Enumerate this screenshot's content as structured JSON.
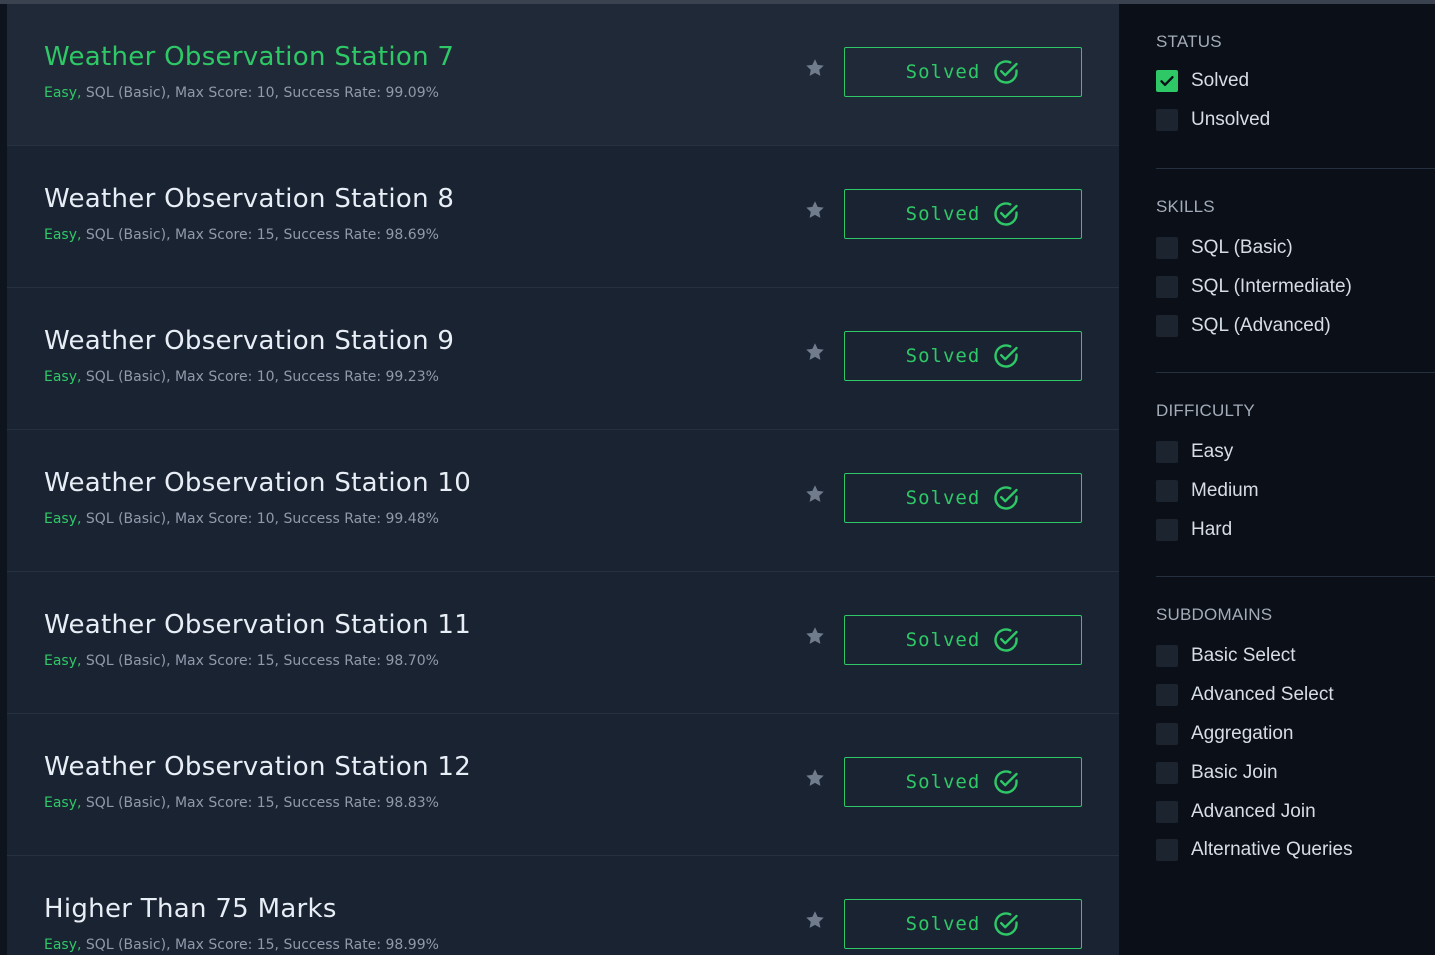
{
  "challenges": [
    {
      "title": "Weather Observation Station 7",
      "difficulty": "Easy,",
      "details": "SQL (Basic), Max Score: 10, Success Rate: 99.09%",
      "button_label": "Solved"
    },
    {
      "title": "Weather Observation Station 8",
      "difficulty": "Easy,",
      "details": "SQL (Basic), Max Score: 15, Success Rate: 98.69%",
      "button_label": "Solved"
    },
    {
      "title": "Weather Observation Station 9",
      "difficulty": "Easy,",
      "details": "SQL (Basic), Max Score: 10, Success Rate: 99.23%",
      "button_label": "Solved"
    },
    {
      "title": "Weather Observation Station 10",
      "difficulty": "Easy,",
      "details": "SQL (Basic), Max Score: 10, Success Rate: 99.48%",
      "button_label": "Solved"
    },
    {
      "title": "Weather Observation Station 11",
      "difficulty": "Easy,",
      "details": "SQL (Basic), Max Score: 15, Success Rate: 98.70%",
      "button_label": "Solved"
    },
    {
      "title": "Weather Observation Station 12",
      "difficulty": "Easy,",
      "details": "SQL (Basic), Max Score: 15, Success Rate: 98.83%",
      "button_label": "Solved"
    },
    {
      "title": "Higher Than 75 Marks",
      "difficulty": "Easy,",
      "details": "SQL (Basic), Max Score: 15, Success Rate: 98.99%",
      "button_label": "Solved"
    }
  ],
  "filters": {
    "status": {
      "heading": "STATUS",
      "options": [
        {
          "label": "Solved",
          "checked": true
        },
        {
          "label": "Unsolved",
          "checked": false
        }
      ]
    },
    "skills": {
      "heading": "SKILLS",
      "options": [
        {
          "label": "SQL (Basic)",
          "checked": false
        },
        {
          "label": "SQL (Intermediate)",
          "checked": false
        },
        {
          "label": "SQL (Advanced)",
          "checked": false
        }
      ]
    },
    "difficulty": {
      "heading": "DIFFICULTY",
      "options": [
        {
          "label": "Easy",
          "checked": false
        },
        {
          "label": "Medium",
          "checked": false
        },
        {
          "label": "Hard",
          "checked": false
        }
      ]
    },
    "subdomains": {
      "heading": "SUBDOMAINS",
      "options": [
        {
          "label": "Basic Select",
          "checked": false
        },
        {
          "label": "Advanced Select",
          "checked": false
        },
        {
          "label": "Aggregation",
          "checked": false
        },
        {
          "label": "Basic Join",
          "checked": false
        },
        {
          "label": "Advanced Join",
          "checked": false
        },
        {
          "label": "Alternative Queries",
          "checked": false
        }
      ]
    }
  },
  "colors": {
    "accent_green": "#2ec866",
    "page_bg": "#1a2332",
    "sidebar_bg": "#0a0f18"
  },
  "icons": {
    "star": "star-icon",
    "check": "check-circle-icon",
    "checkbox_tick": "checkmark-icon"
  }
}
